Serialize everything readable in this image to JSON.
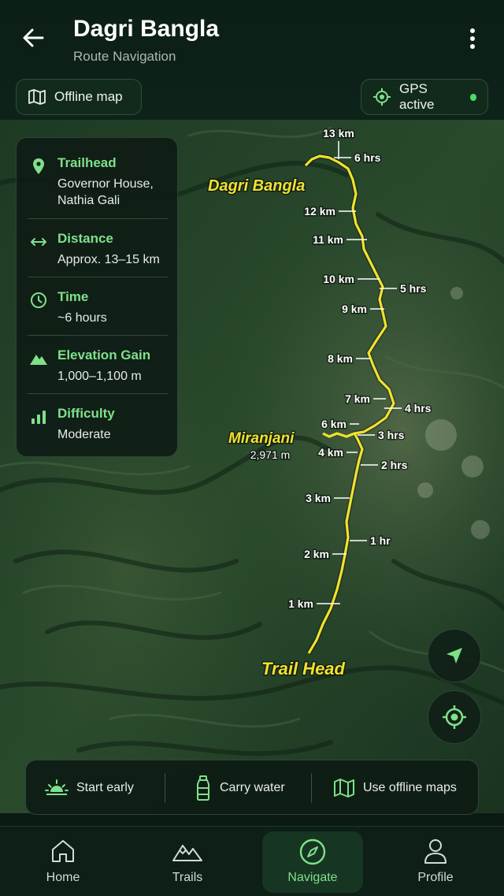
{
  "header": {
    "title": "Dagri Bangla",
    "subtitle": "Route Navigation",
    "offline_map_label": "Offline map",
    "gps_label": "GPS active"
  },
  "info_card": {
    "trailhead": {
      "label": "Trailhead",
      "value_line1": "Governor House,",
      "value_line2": "Nathia Gali"
    },
    "distance": {
      "label": "Distance",
      "value": "Approx. 13–15 km"
    },
    "time": {
      "label": "Time",
      "value": "~6 hours"
    },
    "elevation": {
      "label": "Elevation Gain",
      "value": "1,000–1,100 m"
    },
    "difficulty": {
      "label": "Difficulty",
      "value": "Moderate"
    }
  },
  "map": {
    "route_color": "#f2e12e",
    "places": {
      "destination": "Dagri Bangla",
      "peak": "Miranjani",
      "peak_elevation": "2,971 m",
      "start": "Trail Head"
    },
    "km_markers": [
      "1 km",
      "2 km",
      "3 km",
      "4 km",
      "6 km",
      "7 km",
      "8 km",
      "9 km",
      "10 km",
      "11 km",
      "12 km",
      "13 km"
    ],
    "time_markers": [
      "1 hr",
      "2 hrs",
      "3 hrs",
      "4 hrs",
      "5 hrs",
      "6 hrs"
    ]
  },
  "tips": {
    "start_early": "Start early",
    "carry_water": "Carry water",
    "offline_maps": "Use offline maps"
  },
  "nav": {
    "home": "Home",
    "trails": "Trails",
    "navigate": "Navigate",
    "profile": "Profile"
  },
  "colors": {
    "accent": "#7fe08a",
    "background": "#0b1a12",
    "gps_dot": "#4ddc6b"
  }
}
